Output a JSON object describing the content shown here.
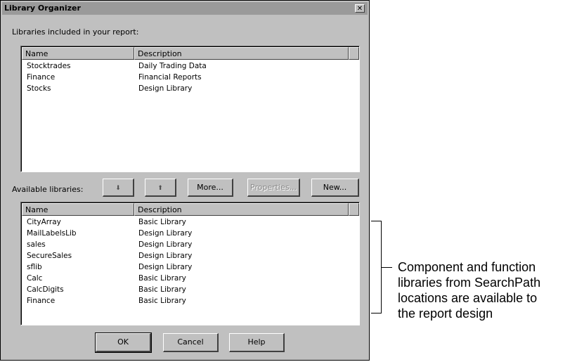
{
  "dialog": {
    "title": "Library Organizer",
    "close_glyph": "✕",
    "included_label": "Libraries included in your report:",
    "available_label": "Available libraries:",
    "included": {
      "columns": [
        "Name",
        "Description"
      ],
      "rows": [
        {
          "name": "Stocktrades",
          "description": "Daily Trading Data"
        },
        {
          "name": "Finance",
          "description": "Financial Reports"
        },
        {
          "name": "Stocks",
          "description": "Design Library"
        }
      ]
    },
    "available": {
      "columns": [
        "Name",
        "Description"
      ],
      "rows": [
        {
          "name": "CityArray",
          "description": "Basic Library"
        },
        {
          "name": "MailLabelsLib",
          "description": "Design Library"
        },
        {
          "name": "sales",
          "description": "Design Library"
        },
        {
          "name": "SecureSales",
          "description": "Design Library"
        },
        {
          "name": "sflib",
          "description": "Design Library"
        },
        {
          "name": "Calc",
          "description": "Basic Library"
        },
        {
          "name": "CalcDigits",
          "description": "Basic Library"
        },
        {
          "name": "Finance",
          "description": "Basic Library"
        }
      ]
    },
    "buttons": {
      "move_down_glyph": "⬇",
      "move_up_glyph": "⬆",
      "more": "More...",
      "properties": "Properties...",
      "new": "New...",
      "ok": "OK",
      "cancel": "Cancel",
      "help": "Help"
    }
  },
  "annotation": {
    "lines": [
      "Component and function",
      "libraries from SearchPath",
      "locations are available to",
      "the report design"
    ]
  }
}
